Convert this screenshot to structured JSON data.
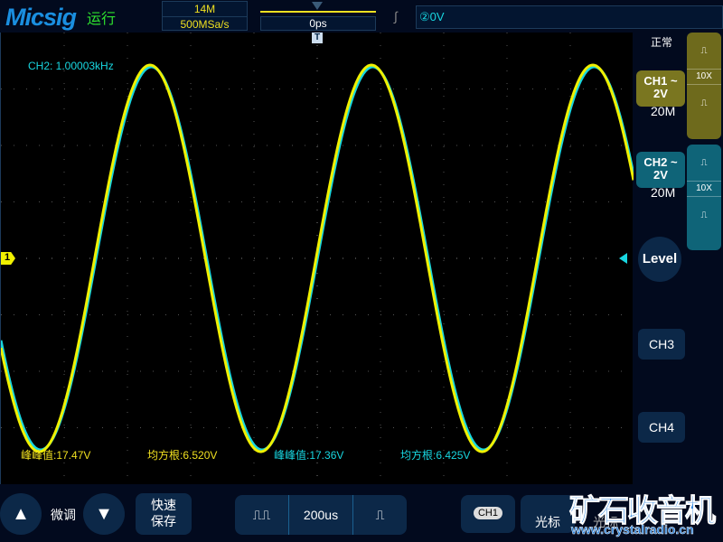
{
  "header": {
    "logo": "Micsig",
    "status": "运行",
    "memory_depth": "14M",
    "sample_rate": "500MSa/s",
    "time_offset": "0ps",
    "trigger_level": "②0V"
  },
  "side": {
    "acq_mode": "正常",
    "ch1": {
      "label": "CH1 ~",
      "scale": "2V",
      "bandwidth": "20M",
      "probe": "10X",
      "color": "#7a7620"
    },
    "ch2": {
      "label": "CH2 ~",
      "scale": "2V",
      "bandwidth": "20M",
      "probe": "10X",
      "color": "#0f6478"
    },
    "level": "Level",
    "ch3": "CH3",
    "ch4": "CH4"
  },
  "plot": {
    "freq_readout": "CH2: 1.00003kHz",
    "ch1_marker": "1",
    "ch1_color": "#f0f000",
    "ch2_color": "#18d6e0"
  },
  "measurements": [
    {
      "label": "峰峰值:17.47V",
      "color": "#f0e020"
    },
    {
      "label": "均方根:6.520V",
      "color": "#f0e020"
    },
    {
      "label": "峰峰值:17.36V",
      "color": "#18d6e0"
    },
    {
      "label": "均方根:6.425V",
      "color": "#18d6e0"
    }
  ],
  "bottom": {
    "fine_label": "微调",
    "quick_save": "快速\n保存",
    "timebase": "200us",
    "ch_select": "CH1",
    "cursor1": "光标",
    "cursor2": "光标"
  },
  "watermark": {
    "title": "矿石收音机",
    "url": "www.crystalradio.cn"
  }
}
